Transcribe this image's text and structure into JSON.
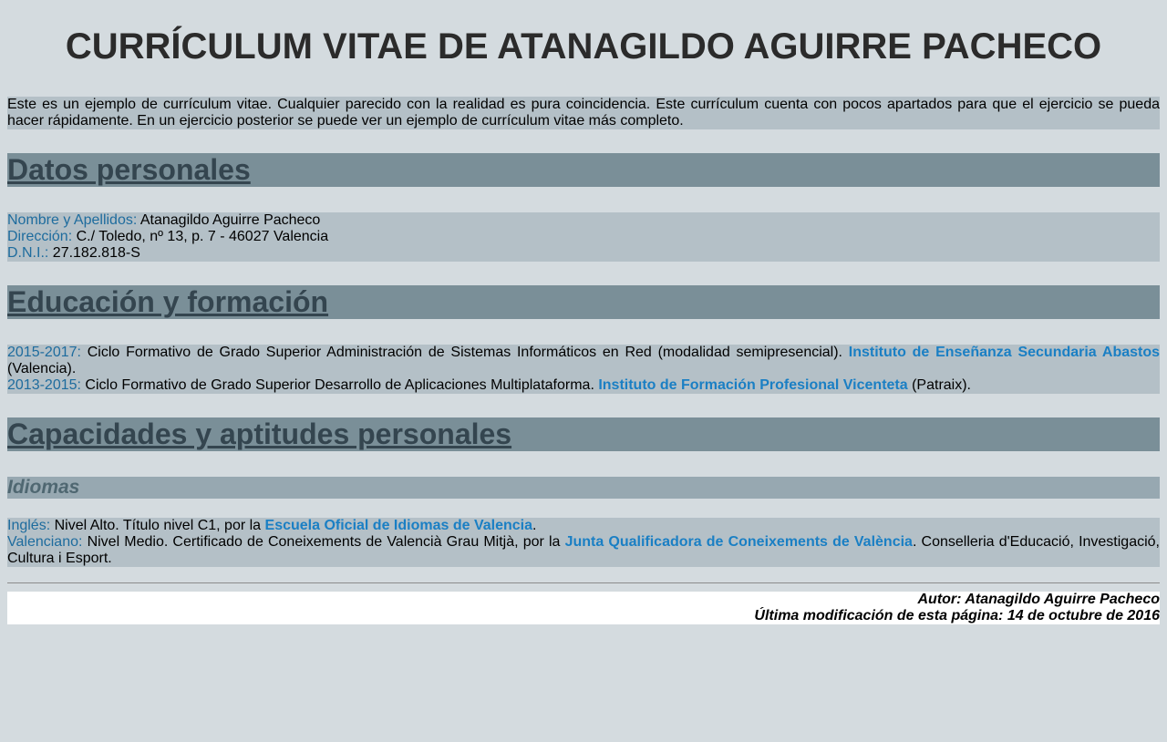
{
  "title": "CURRÍCULUM VITAE DE ATANAGILDO AGUIRRE PACHECO",
  "intro": "Este es un ejemplo de currículum vitae. Cualquier parecido con la realidad es pura coincidencia. Este currículum cuenta con pocos apartados para que el ejercicio se pueda hacer rápidamente. En un ejercicio posterior se puede ver un ejemplo de currículum vitae más completo.",
  "personal": {
    "heading": "Datos personales",
    "rows": [
      {
        "label": "Nombre y Apellidos:",
        "value": " Atanagildo Aguirre Pacheco"
      },
      {
        "label": "Dirección:",
        "value": " C./ Toledo, nº 13, p. 7 - 46027 Valencia"
      },
      {
        "label": "D.N.I.:",
        "value": " 27.182.818-S"
      }
    ]
  },
  "education": {
    "heading": "Educación y formación",
    "rows": [
      {
        "label": "2015-2017:",
        "text": " Ciclo Formativo de Grado Superior Administración de Sistemas Informáticos en Red (modalidad semipresencial). ",
        "link": "Instituto de Enseñanza Secundaria Abastos",
        "after": " (Valencia)."
      },
      {
        "label": "2013-2015:",
        "text": " Ciclo Formativo de Grado Superior Desarrollo de Aplicaciones Multiplataforma. ",
        "link": "Instituto de Formación Profesional Vicenteta",
        "after": " (Patraix)."
      }
    ]
  },
  "skills": {
    "heading": "Capacidades y aptitudes personales",
    "languages_heading": "Idiomas",
    "rows": [
      {
        "label": "Inglés:",
        "text": " Nivel Alto. Título nivel C1, por la ",
        "link": "Escuela Oficial de Idiomas de Valencia",
        "after": "."
      },
      {
        "label": "Valenciano:",
        "text": " Nivel Medio. Certificado de Coneixements de Valencià Grau Mitjà, por la ",
        "link": "Junta Qualificadora de Coneixements de València",
        "after": ". Conselleria d'Educació, Investigació, Cultura i Esport."
      }
    ]
  },
  "footer": {
    "author": "Autor: Atanagildo Aguirre Pacheco",
    "modified": "Última modificación de esta página: 14 de octubre de 2016"
  },
  "colors": {
    "page_bg": "#d4dbdf",
    "section_bg": "#7a8f98",
    "block_bg": "#b4c0c7",
    "label": "#1e6c9e",
    "link": "#1a7fc4"
  }
}
